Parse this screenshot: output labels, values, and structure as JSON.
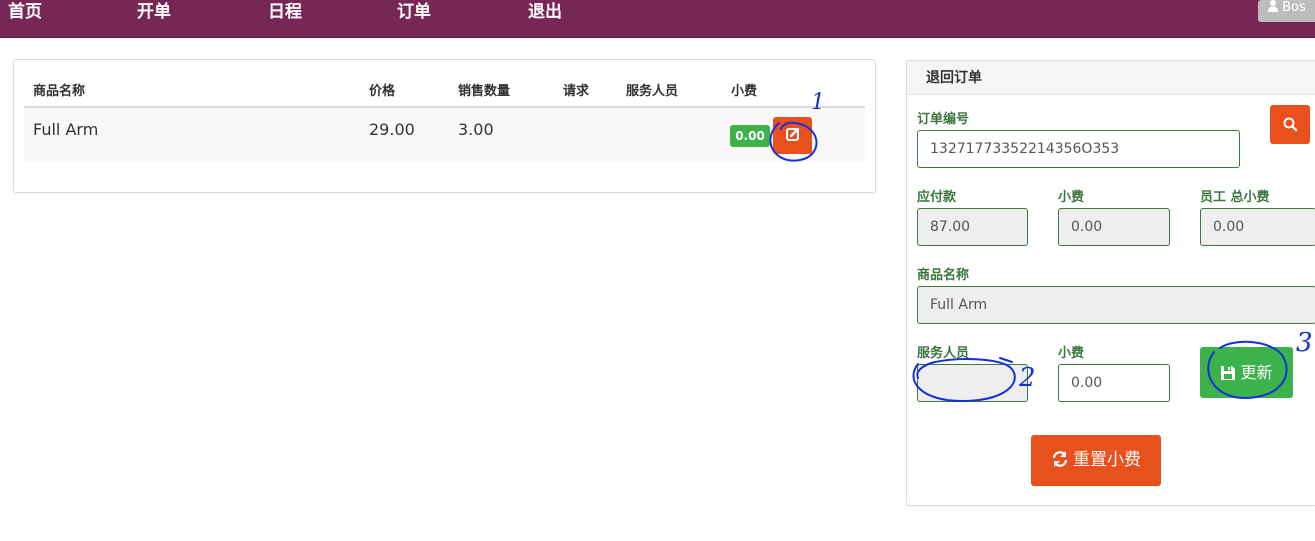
{
  "nav": {
    "items": [
      "首页",
      "开单",
      "日程",
      "订单",
      "退出"
    ],
    "user_label": "Bos"
  },
  "order_table": {
    "headers": [
      "商品名称",
      "价格",
      "销售数量",
      "请求",
      "服务人员",
      "小费"
    ],
    "rows": [
      {
        "name": "Full Arm",
        "price": "29.00",
        "qty": "3.00",
        "request": "",
        "staff": "",
        "tip": "0.00"
      }
    ]
  },
  "return_panel": {
    "title": "退回订单",
    "order_no_label": "订单编号",
    "order_no_value": "13271773352214356O353",
    "amount_due_label": "应付款",
    "amount_due_value": "87.00",
    "tip_label": "小费",
    "tip_value": "0.00",
    "staff_total_tip_label": "员工 总小费",
    "staff_total_tip_value": "0.00",
    "product_name_label": "商品名称",
    "product_name_value": "Full Arm",
    "staff_label": "服务人员",
    "staff_value": "",
    "tip2_label": "小费",
    "tip2_value": "0.00",
    "update_label": "更新",
    "reset_label": "重置小费"
  },
  "annotations": {
    "numbers": [
      "1",
      "2",
      "3"
    ],
    "color": "#1530d8"
  },
  "colors": {
    "nav_bg": "#762754",
    "accent_orange": "#e8501c",
    "accent_green": "#3cb34a",
    "label_green": "#3c763d"
  }
}
